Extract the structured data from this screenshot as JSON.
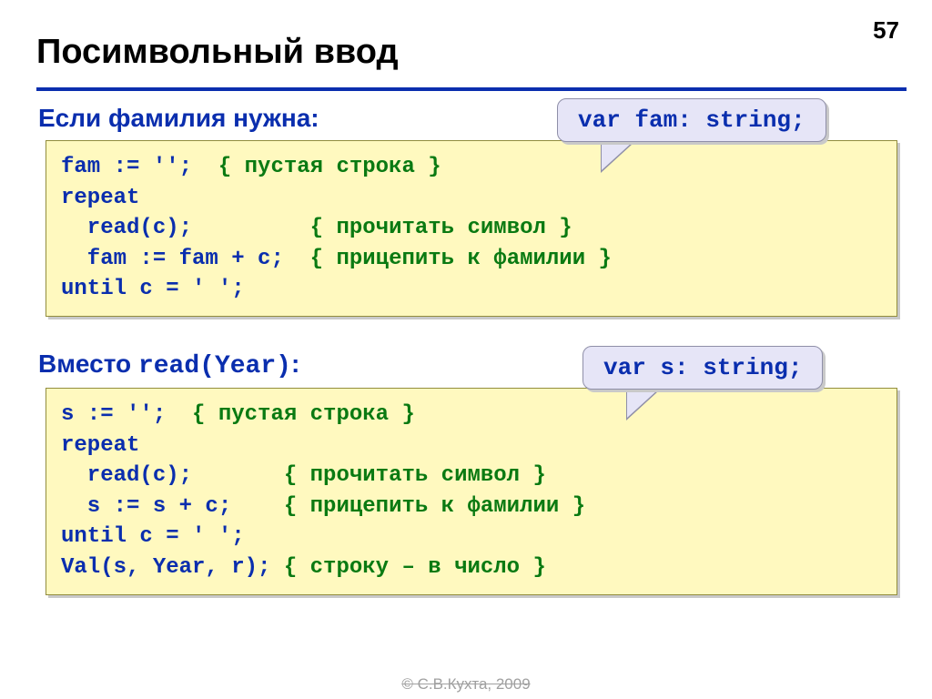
{
  "page_number": "57",
  "title": "Посимвольный ввод",
  "section1": {
    "heading": "Если фамилия нужна:",
    "callout": "var fam: string;",
    "code": {
      "l1a": "fam := '';  ",
      "l1b": "{ пустая строка }",
      "l2": "repeat",
      "l3a": "  read(c);         ",
      "l3b": "{ прочитать символ }",
      "l4a": "  fam := fam + c;  ",
      "l4b": "{ прицепить к фамилии }",
      "l5": "until c = ' ';"
    }
  },
  "section2": {
    "heading_pre": "Вместо ",
    "heading_mono": "read(Year)",
    "heading_post": ":",
    "callout": "var s: string;",
    "code": {
      "l1a": "s := '';  ",
      "l1b": "{ пустая строка }",
      "l2": "repeat",
      "l3a": "  read(c);       ",
      "l3b": "{ прочитать символ }",
      "l4a": "  s := s + c;    ",
      "l4b": "{ прицепить к фамилии }",
      "l5": "until c = ' ';",
      "l6a": "Val(s, Year, r); ",
      "l6b": "{ строку – в число }"
    }
  },
  "footer": "© С.В.Кухта, 2009"
}
